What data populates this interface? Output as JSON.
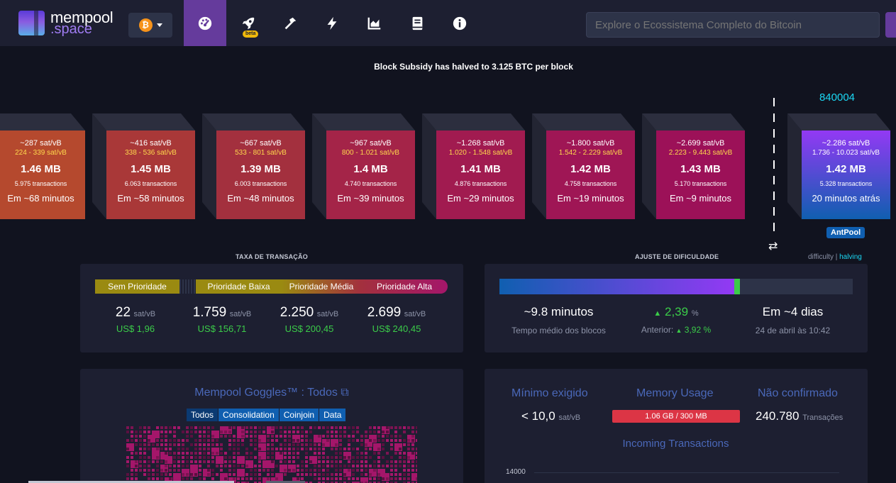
{
  "header": {
    "logo_line1": "mempool",
    "logo_line2": ".space",
    "beta_label": "beta",
    "search_placeholder": "Explore o Ecossistema Completo do Bitcoin"
  },
  "nav_icons": [
    "dashboard-icon",
    "rocket-icon",
    "hammer-icon",
    "lightning-icon",
    "chart-icon",
    "book-icon",
    "info-icon"
  ],
  "announcement": "Block Subsidy has halved to 3.125 BTC per block",
  "projected_blocks": [
    {
      "fee": "~287 sat/vB",
      "range": "224 - 339 sat/vB",
      "size": "1.46 MB",
      "txs": "5.975 transactions",
      "time": "Em ~68 minutos",
      "color": "#b5492e"
    },
    {
      "fee": "~416 sat/vB",
      "range": "338 - 536 sat/vB",
      "size": "1.45 MB",
      "txs": "6.063 transactions",
      "time": "Em ~58 minutos",
      "color": "#a93838"
    },
    {
      "fee": "~667 sat/vB",
      "range": "533 - 801 sat/vB",
      "size": "1.39 MB",
      "txs": "6.003 transactions",
      "time": "Em ~48 minutos",
      "color": "#a3303e"
    },
    {
      "fee": "~967 sat/vB",
      "range": "800 - 1.021 sat/vB",
      "size": "1.4 MB",
      "txs": "4.740 transactions",
      "time": "Em ~39 minutos",
      "color": "#a42448"
    },
    {
      "fee": "~1.268 sat/vB",
      "range": "1.020 - 1.548 sat/vB",
      "size": "1.41 MB",
      "txs": "4.876 transactions",
      "time": "Em ~29 minutos",
      "color": "#a11b50"
    },
    {
      "fee": "~1.800 sat/vB",
      "range": "1.542 - 2.229 sat/vB",
      "size": "1.42 MB",
      "txs": "4.758 transactions",
      "time": "Em ~19 minutos",
      "color": "#9f1655"
    },
    {
      "fee": "~2.699 sat/vB",
      "range": "2.223 - 9.443 sat/vB",
      "size": "1.43 MB",
      "txs": "5.170 transactions",
      "time": "Em ~9 minutos",
      "color": "#9c1158"
    }
  ],
  "mined_block": {
    "height": "840004",
    "fee": "~2.286 sat/vB",
    "range": "1.736 - 10.023 sat/vB",
    "size": "1.42 MB",
    "txs": "5.328 transactions",
    "time": "20 minutos atrás",
    "pool": "AntPool"
  },
  "halving_links": {
    "difficulty": "difficulty",
    "sep": "|",
    "halving": "halving"
  },
  "fees": {
    "title": "TAXA DE TRANSAÇÃO",
    "labels": [
      "Sem Prioridade",
      "Prioridade Baixa",
      "Prioridade Média",
      "Prioridade Alta"
    ],
    "values": [
      "22",
      "1.759",
      "2.250",
      "2.699"
    ],
    "unit": "sat/vB",
    "usd": [
      "US$ 1,96",
      "US$ 156,71",
      "US$ 200,45",
      "US$ 240,45"
    ]
  },
  "difficulty": {
    "title": "AJUSTE DE DIFICULDADE",
    "progress_pct": 66.5,
    "avg_time": "~9.8 minutos",
    "avg_time_label": "Tempo médio dos blocos",
    "change": "2,39",
    "change_unit": "%",
    "previous_label": "Anterior:",
    "previous": "3,92 %",
    "eta": "Em ~4 dias",
    "eta_date": "24 de abril às 10:42"
  },
  "goggles": {
    "title": "Mempool Goggles™ : Todos",
    "tabs": [
      "Todos",
      "Consolidation",
      "Coinjoin",
      "Data"
    ]
  },
  "stats": {
    "min_label": "Mínimo exigido",
    "min_value": "< 10,0",
    "min_unit": "sat/vB",
    "mem_label": "Memory Usage",
    "mem_value": "1.06 GB / 300 MB",
    "unconf_label": "Não confirmado",
    "unconf_value": "240.780",
    "unconf_unit": "Transações",
    "incoming_label": "Incoming Transactions",
    "axis_tick": "14000"
  }
}
